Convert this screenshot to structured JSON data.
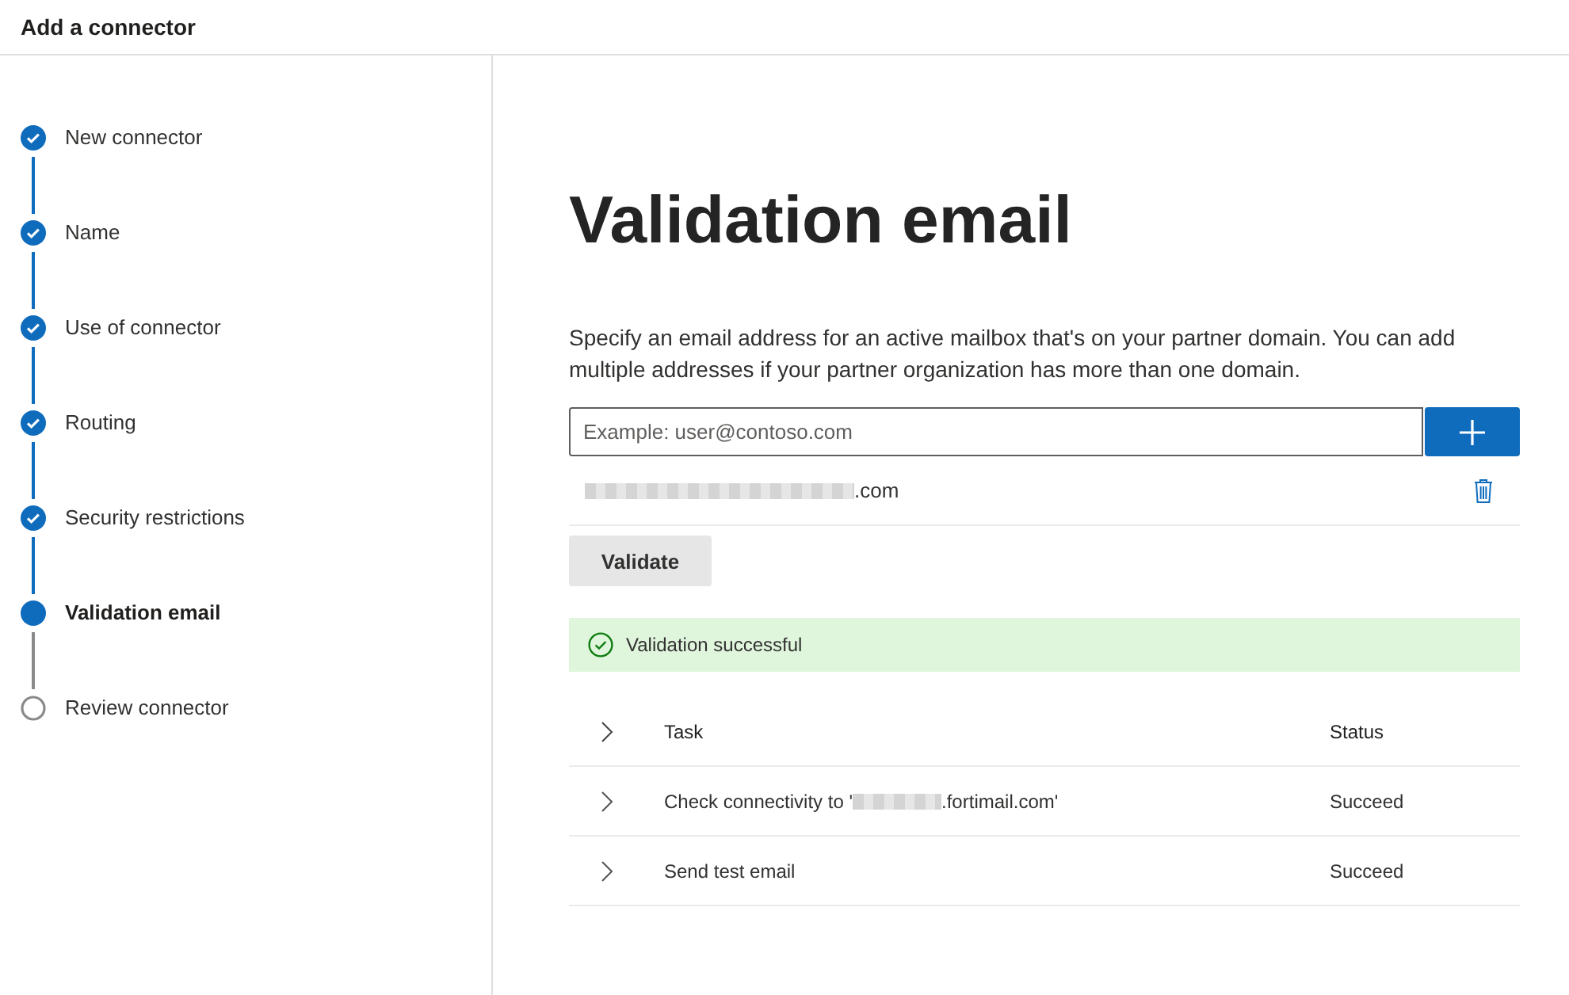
{
  "window": {
    "title": "Add a connector"
  },
  "steps": [
    {
      "label": "New connector",
      "completed": true,
      "selected": false
    },
    {
      "label": "Name",
      "completed": true,
      "selected": false
    },
    {
      "label": "Use of connector",
      "completed": true,
      "selected": false
    },
    {
      "label": "Routing",
      "completed": true,
      "selected": false
    },
    {
      "label": "Security restrictions",
      "completed": true,
      "selected": false
    },
    {
      "label": "Validation email",
      "completed": false,
      "selected": true
    },
    {
      "label": "Review connector",
      "completed": false,
      "selected": false
    }
  ],
  "heading": "Validation email",
  "description": "Specify an email address for an active mailbox that's on your partner domain. You can add multiple addresses if your partner organization has more than one domain.",
  "email_field": {
    "placeholder": "Example: user@contoso.com"
  },
  "emails": [
    {
      "redacted": true,
      "text": ".com"
    }
  ],
  "validate_button": "Validate",
  "banner": {
    "text": "Validation successful"
  },
  "table": {
    "columns": [
      "Task",
      "Status"
    ],
    "rows": [
      {
        "before": "Check connectivity to '",
        "redacted": true,
        "after": ".fortimail.com'",
        "status": "Succeed"
      },
      {
        "before": "Send test email",
        "redacted": false,
        "after": "",
        "status": "Succeed"
      }
    ]
  }
}
